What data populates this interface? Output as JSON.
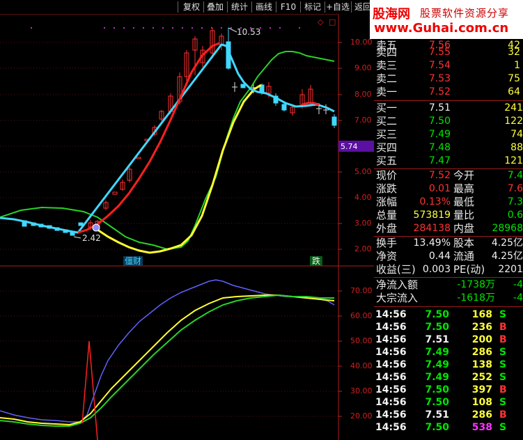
{
  "toolbar": {
    "buttons": [
      "复权",
      "叠加",
      "统计",
      "画线",
      "F10",
      "标记",
      "+自选",
      "返回"
    ]
  },
  "logo": {
    "name": "股海网",
    "slogan": "股票软件资源分享",
    "url": "www.Guhai.com.cn"
  },
  "chart": {
    "price_axis": [
      "10.00",
      "9.00",
      "8.00",
      "7.00",
      "5.00",
      "4.00",
      "3.00",
      "2.00"
    ],
    "price_marker": "5.74",
    "high_label": "10.53",
    "low_label": "2.42",
    "signal_buy": "僵财",
    "signal_sell": "跌",
    "ind_axis": [
      "70.00",
      "60.00",
      "50.00",
      "40.00",
      "30.00",
      "20.00"
    ]
  },
  "quote": {
    "asks": [
      {
        "label": "卖五",
        "price": "7.56",
        "vol": "42"
      },
      {
        "label": "卖四",
        "price": "7.55",
        "vol": "32"
      },
      {
        "label": "卖三",
        "price": "7.54",
        "vol": "1"
      },
      {
        "label": "卖二",
        "price": "7.53",
        "vol": "75"
      },
      {
        "label": "卖一",
        "price": "7.52",
        "vol": "64"
      }
    ],
    "bids": [
      {
        "label": "买一",
        "price": "7.51",
        "vol": "241"
      },
      {
        "label": "买二",
        "price": "7.50",
        "vol": "122"
      },
      {
        "label": "买三",
        "price": "7.49",
        "vol": "74"
      },
      {
        "label": "买四",
        "price": "7.48",
        "vol": "88"
      },
      {
        "label": "买五",
        "price": "7.47",
        "vol": "121"
      }
    ],
    "stats": [
      {
        "l1": "现价",
        "v1": "7.52",
        "c1": "red",
        "l2": "今开",
        "v2": "7.4",
        "c2": "green"
      },
      {
        "l1": "涨跌",
        "v1": "0.01",
        "c1": "red",
        "l2": "最高",
        "v2": "7.6",
        "c2": "red"
      },
      {
        "l1": "涨幅",
        "v1": "0.13%",
        "c1": "red",
        "l2": "最低",
        "v2": "7.3",
        "c2": "green"
      },
      {
        "l1": "总量",
        "v1": "573819",
        "c1": "yellow",
        "l2": "量比",
        "v2": "0.6",
        "c2": "green"
      },
      {
        "l1": "外盘",
        "v1": "284138",
        "c1": "red",
        "l2": "内盘",
        "v2": "28968",
        "c2": "green"
      }
    ],
    "stats2": [
      {
        "l1": "换手",
        "v1": "13.49%",
        "c1": "white",
        "l2": "股本",
        "v2": "4.25亿",
        "c2": "white"
      },
      {
        "l1": "净资",
        "v1": "0.44",
        "c1": "white",
        "l2": "流通",
        "v2": "4.25亿",
        "c2": "white"
      },
      {
        "l1": "收益(三)",
        "v1": "0.003",
        "c1": "white",
        "l2": "PE(动)",
        "v2": "2201",
        "c2": "white"
      }
    ],
    "flows": [
      {
        "label": "净流入额",
        "v1": "-1738万",
        "v2": "-4"
      },
      {
        "label": "大宗流入",
        "v1": "-1618万",
        "v2": "-4"
      }
    ],
    "ticks": [
      {
        "t": "14:56",
        "p": "7.50",
        "pc": "green",
        "v": "168",
        "vc": "yellow",
        "s": "S",
        "sc": "green"
      },
      {
        "t": "14:56",
        "p": "7.50",
        "pc": "green",
        "v": "236",
        "vc": "yellow",
        "s": "B",
        "sc": "red"
      },
      {
        "t": "14:56",
        "p": "7.51",
        "pc": "white",
        "v": "200",
        "vc": "yellow",
        "s": "B",
        "sc": "red"
      },
      {
        "t": "14:56",
        "p": "7.49",
        "pc": "green",
        "v": "286",
        "vc": "yellow",
        "s": "S",
        "sc": "green"
      },
      {
        "t": "14:56",
        "p": "7.49",
        "pc": "green",
        "v": "138",
        "vc": "yellow",
        "s": "S",
        "sc": "green"
      },
      {
        "t": "14:56",
        "p": "7.49",
        "pc": "green",
        "v": "252",
        "vc": "yellow",
        "s": "S",
        "sc": "green"
      },
      {
        "t": "14:56",
        "p": "7.50",
        "pc": "green",
        "v": "397",
        "vc": "yellow",
        "s": "B",
        "sc": "red"
      },
      {
        "t": "14:56",
        "p": "7.50",
        "pc": "green",
        "v": "108",
        "vc": "yellow",
        "s": "S",
        "sc": "green"
      },
      {
        "t": "14:56",
        "p": "7.51",
        "pc": "white",
        "v": "286",
        "vc": "yellow",
        "s": "B",
        "sc": "red"
      },
      {
        "t": "14:56",
        "p": "7.50",
        "pc": "green",
        "v": "538",
        "vc": "mag",
        "s": "S",
        "sc": "green"
      }
    ]
  }
}
